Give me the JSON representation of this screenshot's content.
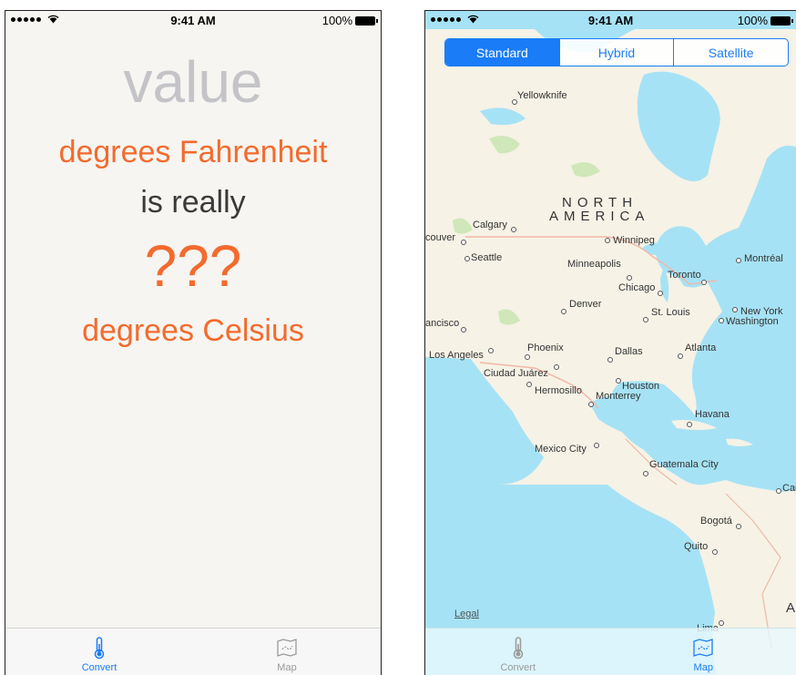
{
  "status_bar": {
    "time": "9:41 AM",
    "battery": "100%"
  },
  "convert": {
    "value_placeholder": "value",
    "from_unit": "degrees Fahrenheit",
    "connector": "is really",
    "result": "???",
    "to_unit": "degrees Celsius"
  },
  "map": {
    "segments": [
      "Standard",
      "Hybrid",
      "Satellite"
    ],
    "selected_segment": "Standard",
    "legal_label": "Legal",
    "continent": [
      "NORTH",
      "AMERICA"
    ],
    "cities": {
      "yellowknife": "Yellowknife",
      "calgary": "Calgary",
      "vancouver": "couver",
      "seattle": "Seattle",
      "winnipeg": "Winnipeg",
      "minneapolis": "Minneapolis",
      "toronto": "Toronto",
      "montreal": "Montréal",
      "chicago": "Chicago",
      "denver": "Denver",
      "san_francisco": "ancisco",
      "st_louis": "St. Louis",
      "new_york": "New York",
      "washington": "Washington",
      "phoenix": "Phoenix",
      "los_angeles": "Los Angeles",
      "dallas": "Dallas",
      "atlanta": "Atlanta",
      "ciudad_juarez": "Ciudad Juárez",
      "houston": "Houston",
      "hermosillo": "Hermosillo",
      "monterrey": "Monterrey",
      "havana": "Havana",
      "mexico_city": "Mexico City",
      "guatemala_city": "Guatemala City",
      "caracas": "Car",
      "bogota": "Bogotá",
      "quito": "Quito",
      "lima": "Lima",
      "south_america": "A"
    }
  },
  "tabs": [
    {
      "label": "Convert",
      "icon": "thermometer-icon"
    },
    {
      "label": "Map",
      "icon": "map-icon"
    }
  ],
  "colors": {
    "accent": "#1a7cf6",
    "orange": "#f36b2e",
    "placeholder_gray": "#c4c4c8",
    "water": "#a6e2f5",
    "land": "#f6f2e6",
    "border_line": "#f0b8a8",
    "park_green": "#cfe7b9"
  }
}
